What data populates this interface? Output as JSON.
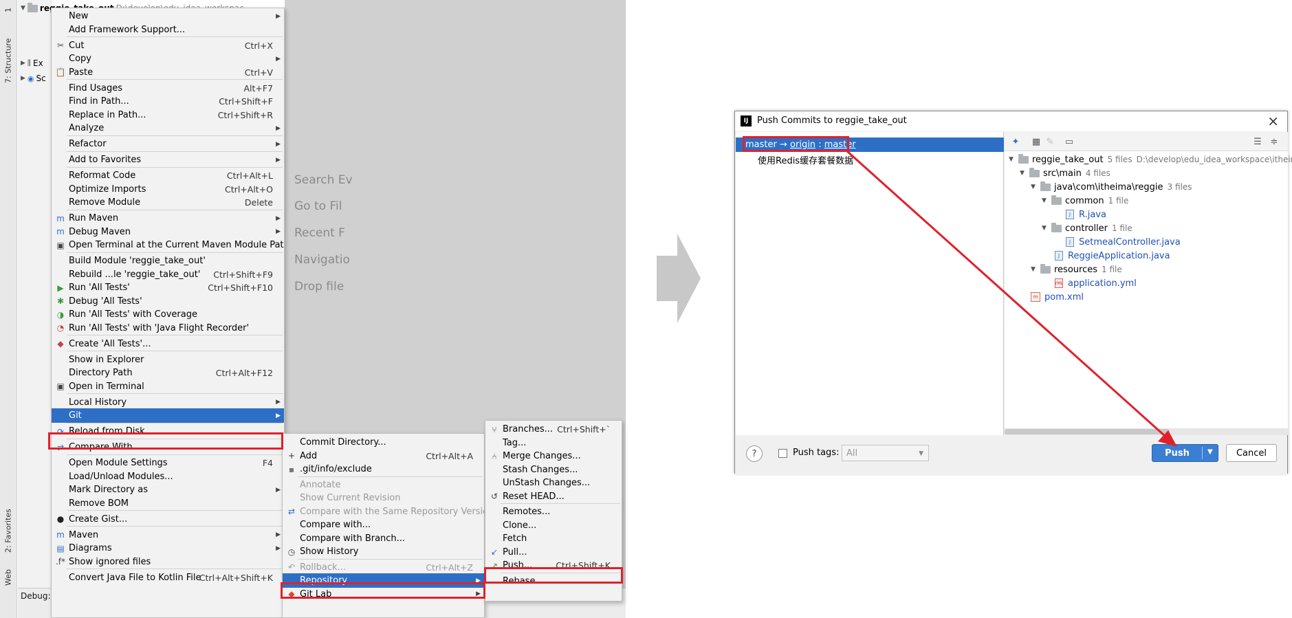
{
  "ide": {
    "vtabs": [
      "1",
      "7: Structure",
      "2: Favorites",
      "Web"
    ],
    "project_root": "reggie_take_out",
    "project_root_path": "D:\\develop\\edu_idea_workspac",
    "tree_rows": [
      "Ex",
      "Sc"
    ],
    "editor_hints": [
      "Search Ev",
      "Go to Fil",
      "Recent F",
      "Navigatio",
      "Drop file"
    ],
    "debug_label": "Debug:"
  },
  "context_menu": {
    "items": [
      {
        "label": "New",
        "shortcut": "",
        "submenu": true,
        "icon": ""
      },
      {
        "label": "Add Framework Support...",
        "shortcut": "",
        "submenu": false,
        "icon": ""
      },
      {
        "label": "Cut",
        "shortcut": "Ctrl+X",
        "submenu": false,
        "icon": "scissors-icon"
      },
      {
        "label": "Copy",
        "shortcut": "",
        "submenu": true,
        "icon": ""
      },
      {
        "label": "Paste",
        "shortcut": "Ctrl+V",
        "submenu": false,
        "icon": "clipboard-icon"
      },
      {
        "label": "Find Usages",
        "shortcut": "Alt+F7",
        "submenu": false,
        "icon": ""
      },
      {
        "label": "Find in Path...",
        "shortcut": "Ctrl+Shift+F",
        "submenu": false,
        "icon": ""
      },
      {
        "label": "Replace in Path...",
        "shortcut": "Ctrl+Shift+R",
        "submenu": false,
        "icon": ""
      },
      {
        "label": "Analyze",
        "shortcut": "",
        "submenu": true,
        "icon": ""
      },
      {
        "label": "Refactor",
        "shortcut": "",
        "submenu": true,
        "icon": ""
      },
      {
        "label": "Add to Favorites",
        "shortcut": "",
        "submenu": true,
        "icon": ""
      },
      {
        "label": "Reformat Code",
        "shortcut": "Ctrl+Alt+L",
        "submenu": false,
        "icon": ""
      },
      {
        "label": "Optimize Imports",
        "shortcut": "Ctrl+Alt+O",
        "submenu": false,
        "icon": ""
      },
      {
        "label": "Remove Module",
        "shortcut": "Delete",
        "submenu": false,
        "icon": ""
      },
      {
        "label": "Run Maven",
        "shortcut": "",
        "submenu": true,
        "icon": "maven-run-icon"
      },
      {
        "label": "Debug Maven",
        "shortcut": "",
        "submenu": true,
        "icon": "maven-debug-icon"
      },
      {
        "label": "Open Terminal at the Current Maven Module Path",
        "shortcut": "",
        "submenu": false,
        "icon": "terminal-icon"
      },
      {
        "label": "Build Module 'reggie_take_out'",
        "shortcut": "",
        "submenu": false,
        "icon": ""
      },
      {
        "label": "Rebuild ...le 'reggie_take_out'",
        "shortcut": "Ctrl+Shift+F9",
        "submenu": false,
        "icon": ""
      },
      {
        "label": "Run 'All Tests'",
        "shortcut": "Ctrl+Shift+F10",
        "submenu": false,
        "icon": "run-icon"
      },
      {
        "label": "Debug 'All Tests'",
        "shortcut": "",
        "submenu": false,
        "icon": "debug-icon"
      },
      {
        "label": "Run 'All Tests' with Coverage",
        "shortcut": "",
        "submenu": false,
        "icon": "coverage-icon"
      },
      {
        "label": "Run 'All Tests' with 'Java Flight Recorder'",
        "shortcut": "",
        "submenu": false,
        "icon": "profiler-icon"
      },
      {
        "label": "Create 'All Tests'...",
        "shortcut": "",
        "submenu": false,
        "icon": "create-test-icon"
      },
      {
        "label": "Show in Explorer",
        "shortcut": "",
        "submenu": false,
        "icon": ""
      },
      {
        "label": "Directory Path",
        "shortcut": "Ctrl+Alt+F12",
        "submenu": false,
        "icon": ""
      },
      {
        "label": "Open in Terminal",
        "shortcut": "",
        "submenu": false,
        "icon": "terminal-icon"
      },
      {
        "label": "Local History",
        "shortcut": "",
        "submenu": true,
        "icon": ""
      },
      {
        "label": "Git",
        "shortcut": "",
        "submenu": true,
        "icon": ""
      },
      {
        "label": "Reload from Disk",
        "shortcut": "",
        "submenu": false,
        "icon": "reload-icon"
      },
      {
        "label": "Compare With...",
        "shortcut": "",
        "submenu": false,
        "icon": "compare-icon"
      },
      {
        "label": "Open Module Settings",
        "shortcut": "F4",
        "submenu": false,
        "icon": ""
      },
      {
        "label": "Load/Unload Modules...",
        "shortcut": "",
        "submenu": false,
        "icon": ""
      },
      {
        "label": "Mark Directory as",
        "shortcut": "",
        "submenu": true,
        "icon": ""
      },
      {
        "label": "Remove BOM",
        "shortcut": "",
        "submenu": false,
        "icon": ""
      },
      {
        "label": "Create Gist...",
        "shortcut": "",
        "submenu": false,
        "icon": "github-icon"
      },
      {
        "label": "Maven",
        "shortcut": "",
        "submenu": true,
        "icon": "maven-icon"
      },
      {
        "label": "Diagrams",
        "shortcut": "",
        "submenu": true,
        "icon": "diagram-icon"
      },
      {
        "label": "Show ignored files",
        "shortcut": "",
        "submenu": false,
        "icon": "ignored-files-icon"
      },
      {
        "label": "Convert Java File to Kotlin File",
        "shortcut": "Ctrl+Alt+Shift+K",
        "submenu": false,
        "icon": ""
      }
    ]
  },
  "git_menu": {
    "items": [
      {
        "label": "Commit Directory...",
        "shortcut": "",
        "submenu": false,
        "disabled": false,
        "icon": ""
      },
      {
        "label": "Add",
        "shortcut": "Ctrl+Alt+A",
        "submenu": false,
        "disabled": false,
        "icon": "plus-icon"
      },
      {
        "label": ".git/info/exclude",
        "shortcut": "",
        "submenu": false,
        "disabled": false,
        "icon": "exclude-file-icon"
      },
      {
        "label": "Annotate",
        "shortcut": "",
        "submenu": false,
        "disabled": true,
        "icon": ""
      },
      {
        "label": "Show Current Revision",
        "shortcut": "",
        "submenu": false,
        "disabled": true,
        "icon": ""
      },
      {
        "label": "Compare with the Same Repository Version",
        "shortcut": "",
        "submenu": false,
        "disabled": true,
        "icon": "compare-icon"
      },
      {
        "label": "Compare with...",
        "shortcut": "",
        "submenu": false,
        "disabled": false,
        "icon": ""
      },
      {
        "label": "Compare with Branch...",
        "shortcut": "",
        "submenu": false,
        "disabled": false,
        "icon": ""
      },
      {
        "label": "Show History",
        "shortcut": "",
        "submenu": false,
        "disabled": false,
        "icon": "history-icon"
      },
      {
        "label": "Rollback...",
        "shortcut": "Ctrl+Alt+Z",
        "submenu": false,
        "disabled": true,
        "icon": "rollback-icon"
      },
      {
        "label": "Repository",
        "shortcut": "",
        "submenu": true,
        "disabled": false,
        "icon": ""
      },
      {
        "label": "Git Lab",
        "shortcut": "",
        "submenu": true,
        "disabled": false,
        "icon": "gitlab-icon"
      }
    ]
  },
  "repo_menu": {
    "items": [
      {
        "label": "Branches...",
        "shortcut": "Ctrl+Shift+`",
        "icon": "branch-icon"
      },
      {
        "label": "Tag...",
        "shortcut": "",
        "icon": ""
      },
      {
        "label": "Merge Changes...",
        "shortcut": "",
        "icon": "merge-icon"
      },
      {
        "label": "Stash Changes...",
        "shortcut": "",
        "icon": ""
      },
      {
        "label": "UnStash Changes...",
        "shortcut": "",
        "icon": ""
      },
      {
        "label": "Reset HEAD...",
        "shortcut": "",
        "icon": "reset-icon"
      },
      {
        "label": "Remotes...",
        "shortcut": "",
        "icon": ""
      },
      {
        "label": "Clone...",
        "shortcut": "",
        "icon": ""
      },
      {
        "label": "Fetch",
        "shortcut": "",
        "icon": ""
      },
      {
        "label": "Pull...",
        "shortcut": "",
        "icon": "pull-icon"
      },
      {
        "label": "Push...",
        "shortcut": "Ctrl+Shift+K",
        "icon": "push-icon"
      },
      {
        "label": "Rebase...",
        "shortcut": "",
        "icon": ""
      }
    ]
  },
  "dialog": {
    "title": "Push Commits to reggie_take_out",
    "branch_local": "master",
    "branch_arrow": "→",
    "branch_remote": "origin",
    "branch_sep": ":",
    "branch_target": "master",
    "commit_message": "使用Redis缓存套餐数据",
    "tree": [
      {
        "name": "reggie_take_out",
        "count": "5 files",
        "extra": "D:\\develop\\edu_idea_workspace\\itheima",
        "kind": "root"
      },
      {
        "name": "src\\main",
        "count": "4 files",
        "extra": "",
        "kind": "folder"
      },
      {
        "name": "java\\com\\itheima\\reggie",
        "count": "3 files",
        "extra": "",
        "kind": "folder"
      },
      {
        "name": "common",
        "count": "1 file",
        "extra": "",
        "kind": "folder"
      },
      {
        "name": "R.java",
        "count": "",
        "extra": "",
        "kind": "java"
      },
      {
        "name": "controller",
        "count": "1 file",
        "extra": "",
        "kind": "folder"
      },
      {
        "name": "SetmealController.java",
        "count": "",
        "extra": "",
        "kind": "java"
      },
      {
        "name": "ReggieApplication.java",
        "count": "",
        "extra": "",
        "kind": "java"
      },
      {
        "name": "resources",
        "count": "1 file",
        "extra": "",
        "kind": "folder"
      },
      {
        "name": "application.yml",
        "count": "",
        "extra": "",
        "kind": "yml"
      },
      {
        "name": "pom.xml",
        "count": "",
        "extra": "",
        "kind": "maven"
      }
    ],
    "help": "?",
    "push_tags_label": "Push tags:",
    "tags_value": "All",
    "push_label": "Push",
    "cancel_label": "Cancel"
  },
  "colors": {
    "selection": "#2e6fc6",
    "highlight_box": "#e0212b",
    "push_button": "#3b7fd4"
  }
}
